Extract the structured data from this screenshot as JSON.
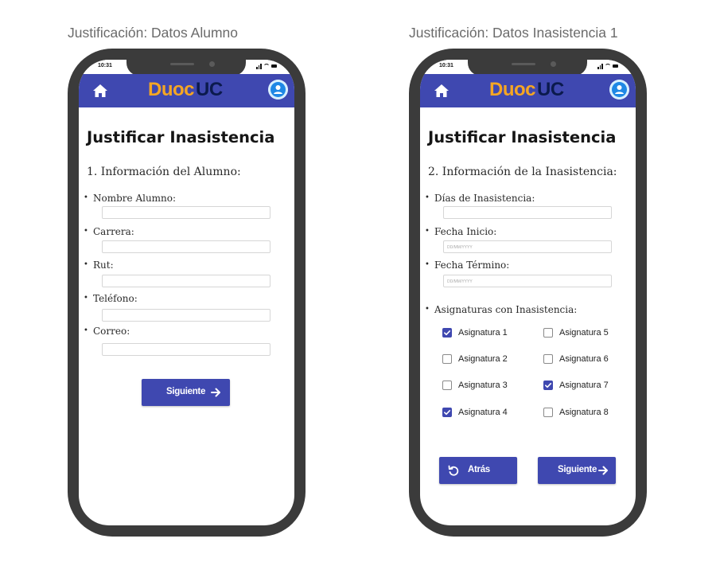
{
  "frames": [
    {
      "title": "Justificación: Datos Alumno",
      "time": "10:31",
      "logo": {
        "duoc": "Duoc",
        "uc": "UC"
      },
      "page_title": "Justificar Inasistencia",
      "section": "1. Información del Alumno:",
      "fields": [
        {
          "label": "Nombre Alumno:",
          "value": ""
        },
        {
          "label": "Carrera:",
          "value": ""
        },
        {
          "label": "Rut:",
          "value": ""
        },
        {
          "label": "Teléfono:",
          "value": ""
        },
        {
          "label": "Correo:",
          "value": ""
        }
      ],
      "next_label": "Siguiente"
    },
    {
      "title": "Justificación: Datos Inasistencia 1",
      "time": "10:31",
      "logo": {
        "duoc": "Duoc",
        "uc": "UC"
      },
      "page_title": "Justificar Inasistencia",
      "section": "2. Información de la Inasistencia:",
      "fields": [
        {
          "label": "Días de Inasistencia:",
          "value": "",
          "placeholder": ""
        },
        {
          "label": "Fecha Inicio:",
          "value": "",
          "placeholder": "DD/MM/YYYY"
        },
        {
          "label": "Fecha Término:",
          "value": "",
          "placeholder": "DD/MM/YYYY"
        }
      ],
      "subjects_label": "Asignaturas con Inasistencia:",
      "subjects": [
        {
          "name": "Asignatura 1",
          "checked": true
        },
        {
          "name": "Asignatura 2",
          "checked": false
        },
        {
          "name": "Asignatura 3",
          "checked": false
        },
        {
          "name": "Asignatura 4",
          "checked": true
        },
        {
          "name": "Asignatura 5",
          "checked": false
        },
        {
          "name": "Asignatura 6",
          "checked": false
        },
        {
          "name": "Asignatura 7",
          "checked": true
        },
        {
          "name": "Asignatura 8",
          "checked": false
        }
      ],
      "back_label": "Atrás",
      "next_label": "Siguiente"
    }
  ],
  "colors": {
    "appbar": "#3f48b0",
    "button": "#3f48b0",
    "logo_duoc": "#f5a623",
    "logo_uc": "#0b1a4d",
    "phone_frame": "#3b3b3b"
  },
  "icons": {
    "home": "home-icon",
    "avatar": "user-avatar-icon",
    "next": "arrow-right-icon",
    "back": "undo-icon",
    "check": "checkmark-icon"
  }
}
